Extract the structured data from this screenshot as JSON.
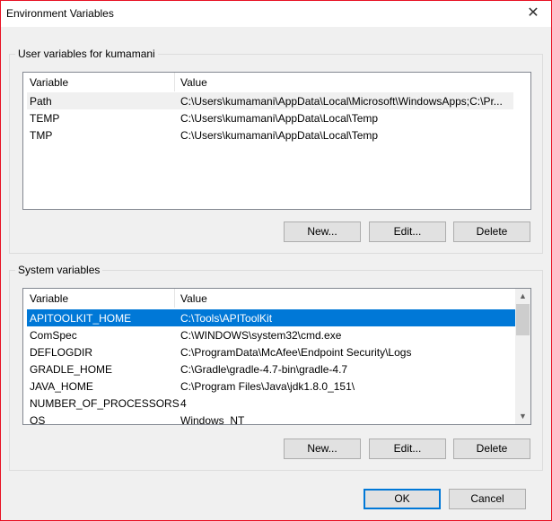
{
  "window": {
    "title": "Environment Variables",
    "close_glyph": "✕"
  },
  "user_vars": {
    "label": "User variables for kumamani",
    "columns": [
      "Variable",
      "Value"
    ],
    "rows": [
      {
        "name": "Path",
        "value": "C:\\Users\\kumamani\\AppData\\Local\\Microsoft\\WindowsApps;C:\\Pr..."
      },
      {
        "name": "TEMP",
        "value": "C:\\Users\\kumamani\\AppData\\Local\\Temp"
      },
      {
        "name": "TMP",
        "value": "C:\\Users\\kumamani\\AppData\\Local\\Temp"
      }
    ],
    "buttons": {
      "new": "New...",
      "edit": "Edit...",
      "delete": "Delete"
    }
  },
  "system_vars": {
    "label": "System variables",
    "columns": [
      "Variable",
      "Value"
    ],
    "rows": [
      {
        "name": "APITOOLKIT_HOME",
        "value": "C:\\Tools\\APIToolKit"
      },
      {
        "name": "ComSpec",
        "value": "C:\\WINDOWS\\system32\\cmd.exe"
      },
      {
        "name": "DEFLOGDIR",
        "value": "C:\\ProgramData\\McAfee\\Endpoint Security\\Logs"
      },
      {
        "name": "GRADLE_HOME",
        "value": "C:\\Gradle\\gradle-4.7-bin\\gradle-4.7"
      },
      {
        "name": "JAVA_HOME",
        "value": "C:\\Program Files\\Java\\jdk1.8.0_151\\"
      },
      {
        "name": "NUMBER_OF_PROCESSORS",
        "value": "4"
      },
      {
        "name": "OS",
        "value": "Windows_NT"
      }
    ],
    "buttons": {
      "new": "New...",
      "edit": "Edit...",
      "delete": "Delete"
    },
    "scroll": {
      "up": "▲",
      "down": "▼"
    }
  },
  "footer": {
    "ok": "OK",
    "cancel": "Cancel"
  }
}
